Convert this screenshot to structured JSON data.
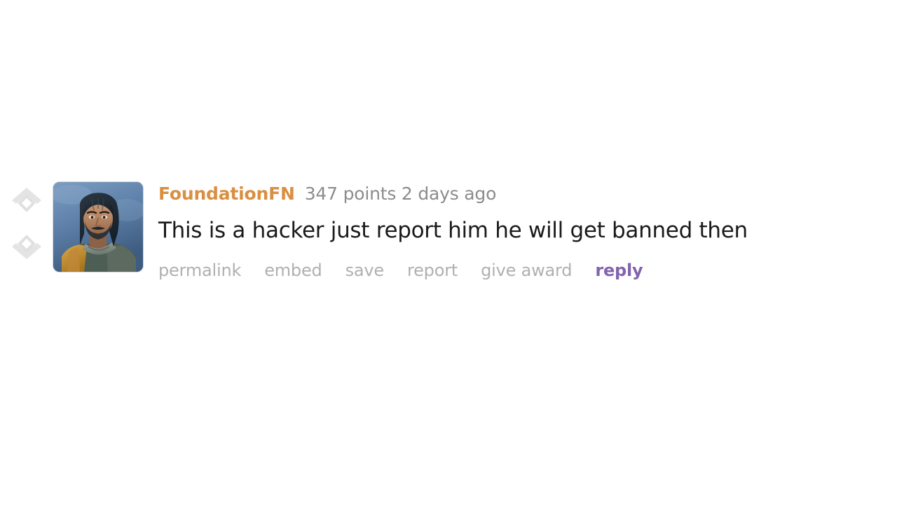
{
  "comment": {
    "author": "FoundationFN",
    "meta": "347 points 2 days ago",
    "points": 347,
    "points_label": "347 points",
    "age": "2 days ago",
    "text": "This is a hacker just report him he will get banned then",
    "avatar_alt": "FoundationFN avatar",
    "vote": {
      "upvote_icon": "upvote-arrow-icon",
      "downvote_icon": "downvote-arrow-icon",
      "arrow_color": "#e2e2e2"
    },
    "actions": [
      {
        "label": "permalink",
        "name": "permalink-link",
        "style": "muted"
      },
      {
        "label": "embed",
        "name": "embed-link",
        "style": "muted"
      },
      {
        "label": "save",
        "name": "save-link",
        "style": "muted"
      },
      {
        "label": "report",
        "name": "report-link",
        "style": "muted"
      },
      {
        "label": "give award",
        "name": "give-award-link",
        "style": "muted"
      },
      {
        "label": "reply",
        "name": "reply-link",
        "style": "accent"
      }
    ]
  },
  "colors": {
    "background": "#ffffff",
    "author_orange": "#d98f42",
    "meta_gray": "#8c8c8c",
    "body_text": "#1a1a1a",
    "action_gray": "#b0b0b0",
    "reply_purple": "#8264ae",
    "vote_arrow": "#e2e2e2"
  }
}
